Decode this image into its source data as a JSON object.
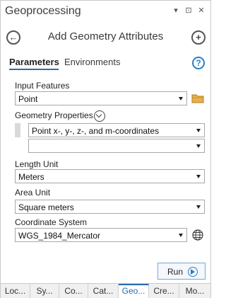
{
  "window": {
    "title": "Geoprocessing",
    "controls": {
      "dropdown": "▾",
      "pin": "⊡",
      "close": "✕"
    }
  },
  "header": {
    "back_symbol": "←",
    "tool_title": "Add Geometry Attributes",
    "add_symbol": "+"
  },
  "tabs": [
    {
      "label": "Parameters",
      "active": true
    },
    {
      "label": "Environments",
      "active": false
    }
  ],
  "help_symbol": "?",
  "parameters": {
    "input_features": {
      "label": "Input Features",
      "value": "Point"
    },
    "geometry_properties": {
      "label": "Geometry Properties",
      "values": [
        "Point x-, y-, z-, and m-coordinates",
        ""
      ]
    },
    "length_unit": {
      "label": "Length Unit",
      "value": "Meters"
    },
    "area_unit": {
      "label": "Area Unit",
      "value": "Square meters"
    },
    "coordinate_system": {
      "label": "Coordinate System",
      "value": "WGS_1984_Mercator"
    }
  },
  "run_button": {
    "label": "Run"
  },
  "bottom_tabs": [
    {
      "label": "Loc...",
      "active": false
    },
    {
      "label": "Sy...",
      "active": false
    },
    {
      "label": "Co...",
      "active": false
    },
    {
      "label": "Cat...",
      "active": false
    },
    {
      "label": "Geo...",
      "active": true
    },
    {
      "label": "Cre...",
      "active": false
    },
    {
      "label": "Mo...",
      "active": false
    }
  ],
  "colors": {
    "accent": "#2b6cb0",
    "folder": "#e8b04a"
  }
}
